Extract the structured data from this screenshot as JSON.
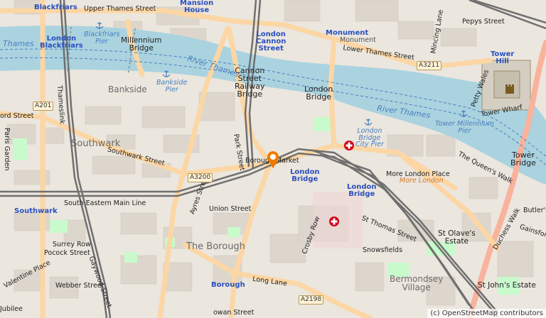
{
  "map": {
    "districts": {
      "southwark": "Southwark",
      "the_borough": "The Borough",
      "bankside": "Bankside",
      "bermondsey_village": "Bermondsey\nVillage",
      "st_olaves": "St Olave's\nEstate",
      "st_johns": "St John's Estate"
    },
    "stations": {
      "blackfriars_top": "Blackfriars",
      "mansion_house": "Mansion\nHouse",
      "london_blackfriars": "London\nBlackfriars",
      "london_cannon_street": "London\nCannon\nStreet",
      "monument_station": "Monument",
      "tower_hill_station": "Tower\nHill",
      "london_bridge_tube": "London\nBridge",
      "london_bridge_rail": "London\nBridge",
      "southwark_station": "Southwark",
      "borough_station": "Borough"
    },
    "water": {
      "thames_left": "Thames",
      "river_thames_1": "River Thames",
      "river_thames_2": "River Thames",
      "blackfriars_pier": "Blackfriars\nPier",
      "bankside_pier": "Bankside\nPier",
      "london_bridge_city_pier": "London\nBridge\nCity Pier",
      "tower_millennium_pier": "Tower Millennium\nPier"
    },
    "bridges": {
      "millennium": "Millennium\nBridge",
      "cannon_street_railway": "Cannon\nStreet\nRailway\nBridge",
      "london_bridge": "London\nBridge",
      "tower_bridge": "Tower\nBridge"
    },
    "roads": {
      "upper_thames": "Upper Thames Street",
      "lower_thames": "Lower Thames Street",
      "southwark_street": "Southwark Street",
      "union_street": "Union Street",
      "long_lane": "Long Lane",
      "st_thomas": "St Thomas Street",
      "snowsfields": "Snowsfields",
      "more_london_place": "More London Place",
      "more_london": "More London",
      "queens_walk": "The Queen's Walk",
      "duchess_walk": "Duchess Walk",
      "gainsford": "Gainsford",
      "tower_wharf": "Tower Wharf",
      "petty_wales": "Petty Wales",
      "pepys_street": "Pepys Street",
      "mincing_lane": "Mincing Lane",
      "ford_street": "ord Street",
      "paris_garden": "Paris Garden",
      "park_street": "Park Street",
      "borough_market": "Borough Market",
      "se_main_line": "South Eastern Main Line",
      "surrey_row": "Surrey Row",
      "pocock_street": "Pocock Street",
      "valentine_place": "Valentine Place",
      "webber_street": "Webber Street",
      "gaywood_street": "Gaywood Street",
      "ayres_street": "Ayres Street",
      "crosby_row": "Crosby Row",
      "butlers": "Butler's",
      "jubilee": "Jubilee",
      "cowan_street": "owan Street",
      "thameslink": "Thameslink",
      "monument_street": "Monument"
    },
    "shields": {
      "a201": "A201",
      "a3200": "A3200",
      "a3211": "A3211",
      "a2198": "A2198"
    },
    "attribution": "(c) OpenStreetMap contributors",
    "colors": {
      "background": "#f2efe9",
      "water": "#aad3df",
      "primary_road": "#fcd6a4",
      "trunk_road": "#f9b29c",
      "rail": "#707070",
      "marker": "#f07a00",
      "park": "#c8facc",
      "hospital": "#d0021b"
    },
    "marker_icon": "location-pin-icon",
    "hospital_icon": "hospital-cross-icon"
  }
}
